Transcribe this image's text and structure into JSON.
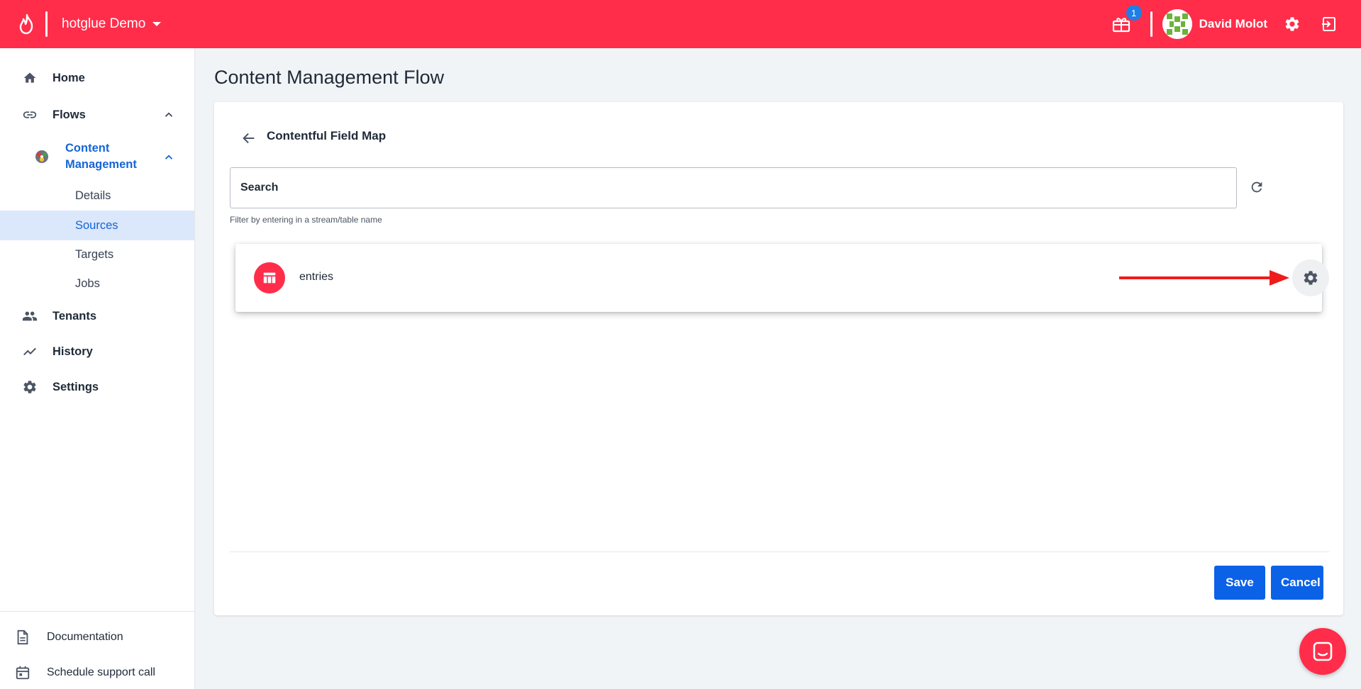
{
  "header": {
    "workspace": "hotglue Demo",
    "notification_count": "1",
    "user_name": "David Molot"
  },
  "sidebar": {
    "items": [
      {
        "label": "Home"
      },
      {
        "label": "Flows"
      },
      {
        "label": "Tenants"
      },
      {
        "label": "History"
      },
      {
        "label": "Settings"
      }
    ],
    "flow": {
      "label": "Content Management"
    },
    "sub_items": [
      {
        "label": "Details"
      },
      {
        "label": "Sources",
        "active": true
      },
      {
        "label": "Targets"
      },
      {
        "label": "Jobs"
      }
    ],
    "bottom": [
      {
        "label": "Documentation"
      },
      {
        "label": "Schedule support call"
      }
    ]
  },
  "main": {
    "page_title": "Content Management Flow",
    "card_title": "Contentful Field Map",
    "search": {
      "placeholder": "Search",
      "value": ""
    },
    "helper_text": "Filter by entering in a stream/table name",
    "streams": [
      {
        "name": "entries"
      }
    ],
    "save_label": "Save",
    "cancel_label": "Cancel"
  },
  "colors": {
    "brand": "#ff2d4a",
    "primary": "#0b62e6",
    "active_bg": "#dbe7fb",
    "annotation_arrow": "#ef1c1c"
  }
}
